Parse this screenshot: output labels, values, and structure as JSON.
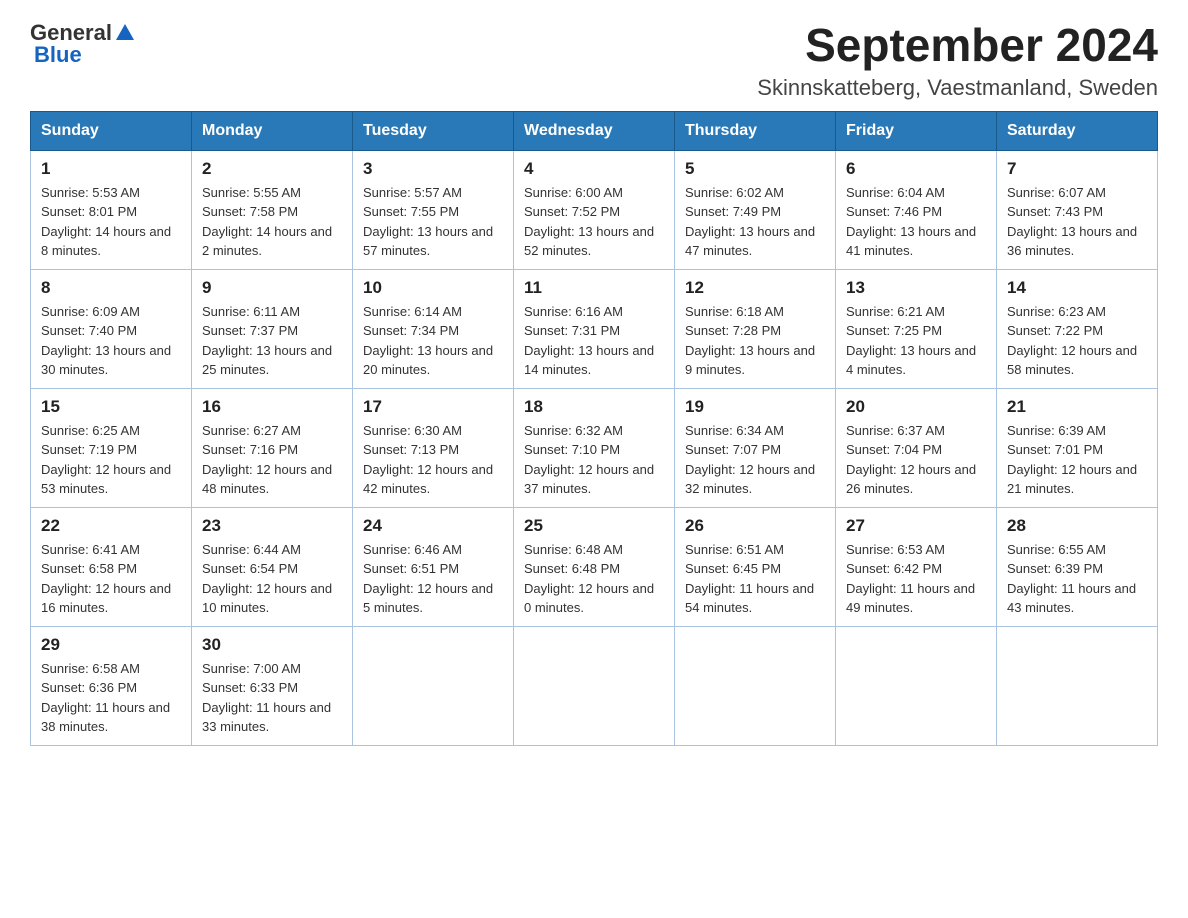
{
  "header": {
    "logo_general": "General",
    "logo_blue": "Blue",
    "month_year": "September 2024",
    "location": "Skinnskatteberg, Vaestmanland, Sweden"
  },
  "days_of_week": [
    "Sunday",
    "Monday",
    "Tuesday",
    "Wednesday",
    "Thursday",
    "Friday",
    "Saturday"
  ],
  "weeks": [
    [
      {
        "day": "1",
        "sunrise": "5:53 AM",
        "sunset": "8:01 PM",
        "daylight": "14 hours and 8 minutes."
      },
      {
        "day": "2",
        "sunrise": "5:55 AM",
        "sunset": "7:58 PM",
        "daylight": "14 hours and 2 minutes."
      },
      {
        "day": "3",
        "sunrise": "5:57 AM",
        "sunset": "7:55 PM",
        "daylight": "13 hours and 57 minutes."
      },
      {
        "day": "4",
        "sunrise": "6:00 AM",
        "sunset": "7:52 PM",
        "daylight": "13 hours and 52 minutes."
      },
      {
        "day": "5",
        "sunrise": "6:02 AM",
        "sunset": "7:49 PM",
        "daylight": "13 hours and 47 minutes."
      },
      {
        "day": "6",
        "sunrise": "6:04 AM",
        "sunset": "7:46 PM",
        "daylight": "13 hours and 41 minutes."
      },
      {
        "day": "7",
        "sunrise": "6:07 AM",
        "sunset": "7:43 PM",
        "daylight": "13 hours and 36 minutes."
      }
    ],
    [
      {
        "day": "8",
        "sunrise": "6:09 AM",
        "sunset": "7:40 PM",
        "daylight": "13 hours and 30 minutes."
      },
      {
        "day": "9",
        "sunrise": "6:11 AM",
        "sunset": "7:37 PM",
        "daylight": "13 hours and 25 minutes."
      },
      {
        "day": "10",
        "sunrise": "6:14 AM",
        "sunset": "7:34 PM",
        "daylight": "13 hours and 20 minutes."
      },
      {
        "day": "11",
        "sunrise": "6:16 AM",
        "sunset": "7:31 PM",
        "daylight": "13 hours and 14 minutes."
      },
      {
        "day": "12",
        "sunrise": "6:18 AM",
        "sunset": "7:28 PM",
        "daylight": "13 hours and 9 minutes."
      },
      {
        "day": "13",
        "sunrise": "6:21 AM",
        "sunset": "7:25 PM",
        "daylight": "13 hours and 4 minutes."
      },
      {
        "day": "14",
        "sunrise": "6:23 AM",
        "sunset": "7:22 PM",
        "daylight": "12 hours and 58 minutes."
      }
    ],
    [
      {
        "day": "15",
        "sunrise": "6:25 AM",
        "sunset": "7:19 PM",
        "daylight": "12 hours and 53 minutes."
      },
      {
        "day": "16",
        "sunrise": "6:27 AM",
        "sunset": "7:16 PM",
        "daylight": "12 hours and 48 minutes."
      },
      {
        "day": "17",
        "sunrise": "6:30 AM",
        "sunset": "7:13 PM",
        "daylight": "12 hours and 42 minutes."
      },
      {
        "day": "18",
        "sunrise": "6:32 AM",
        "sunset": "7:10 PM",
        "daylight": "12 hours and 37 minutes."
      },
      {
        "day": "19",
        "sunrise": "6:34 AM",
        "sunset": "7:07 PM",
        "daylight": "12 hours and 32 minutes."
      },
      {
        "day": "20",
        "sunrise": "6:37 AM",
        "sunset": "7:04 PM",
        "daylight": "12 hours and 26 minutes."
      },
      {
        "day": "21",
        "sunrise": "6:39 AM",
        "sunset": "7:01 PM",
        "daylight": "12 hours and 21 minutes."
      }
    ],
    [
      {
        "day": "22",
        "sunrise": "6:41 AM",
        "sunset": "6:58 PM",
        "daylight": "12 hours and 16 minutes."
      },
      {
        "day": "23",
        "sunrise": "6:44 AM",
        "sunset": "6:54 PM",
        "daylight": "12 hours and 10 minutes."
      },
      {
        "day": "24",
        "sunrise": "6:46 AM",
        "sunset": "6:51 PM",
        "daylight": "12 hours and 5 minutes."
      },
      {
        "day": "25",
        "sunrise": "6:48 AM",
        "sunset": "6:48 PM",
        "daylight": "12 hours and 0 minutes."
      },
      {
        "day": "26",
        "sunrise": "6:51 AM",
        "sunset": "6:45 PM",
        "daylight": "11 hours and 54 minutes."
      },
      {
        "day": "27",
        "sunrise": "6:53 AM",
        "sunset": "6:42 PM",
        "daylight": "11 hours and 49 minutes."
      },
      {
        "day": "28",
        "sunrise": "6:55 AM",
        "sunset": "6:39 PM",
        "daylight": "11 hours and 43 minutes."
      }
    ],
    [
      {
        "day": "29",
        "sunrise": "6:58 AM",
        "sunset": "6:36 PM",
        "daylight": "11 hours and 38 minutes."
      },
      {
        "day": "30",
        "sunrise": "7:00 AM",
        "sunset": "6:33 PM",
        "daylight": "11 hours and 33 minutes."
      },
      {
        "day": "",
        "sunrise": "",
        "sunset": "",
        "daylight": ""
      },
      {
        "day": "",
        "sunrise": "",
        "sunset": "",
        "daylight": ""
      },
      {
        "day": "",
        "sunrise": "",
        "sunset": "",
        "daylight": ""
      },
      {
        "day": "",
        "sunrise": "",
        "sunset": "",
        "daylight": ""
      },
      {
        "day": "",
        "sunrise": "",
        "sunset": "",
        "daylight": ""
      }
    ]
  ]
}
